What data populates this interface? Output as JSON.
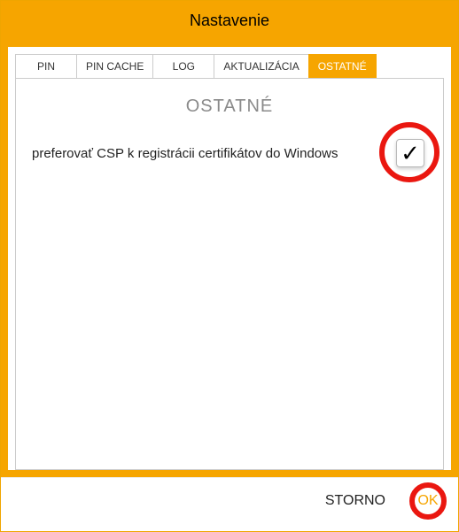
{
  "window": {
    "title": "Nastavenie"
  },
  "tabs": {
    "pin": "PIN",
    "pin_cache": "PIN CACHE",
    "log": "LOG",
    "update": "AKTUALIZÁCIA",
    "other": "OSTATNÉ"
  },
  "section": {
    "title": "OSTATNÉ",
    "pref_csp_label": "preferovať CSP k registrácii certifikátov do Windows",
    "pref_csp_checked": "✓"
  },
  "footer": {
    "cancel": "STORNO",
    "ok": "OK"
  },
  "colors": {
    "accent": "#f6a500",
    "ring": "#ea1710"
  }
}
